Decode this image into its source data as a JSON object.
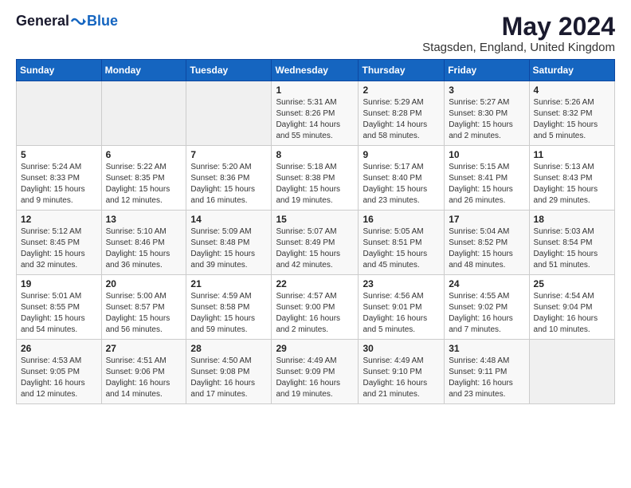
{
  "logo": {
    "general": "General",
    "blue": "Blue"
  },
  "title": "May 2024",
  "subtitle": "Stagsden, England, United Kingdom",
  "headers": [
    "Sunday",
    "Monday",
    "Tuesday",
    "Wednesday",
    "Thursday",
    "Friday",
    "Saturday"
  ],
  "weeks": [
    [
      {
        "day": "",
        "info": ""
      },
      {
        "day": "",
        "info": ""
      },
      {
        "day": "",
        "info": ""
      },
      {
        "day": "1",
        "info": "Sunrise: 5:31 AM\nSunset: 8:26 PM\nDaylight: 14 hours\nand 55 minutes."
      },
      {
        "day": "2",
        "info": "Sunrise: 5:29 AM\nSunset: 8:28 PM\nDaylight: 14 hours\nand 58 minutes."
      },
      {
        "day": "3",
        "info": "Sunrise: 5:27 AM\nSunset: 8:30 PM\nDaylight: 15 hours\nand 2 minutes."
      },
      {
        "day": "4",
        "info": "Sunrise: 5:26 AM\nSunset: 8:32 PM\nDaylight: 15 hours\nand 5 minutes."
      }
    ],
    [
      {
        "day": "5",
        "info": "Sunrise: 5:24 AM\nSunset: 8:33 PM\nDaylight: 15 hours\nand 9 minutes."
      },
      {
        "day": "6",
        "info": "Sunrise: 5:22 AM\nSunset: 8:35 PM\nDaylight: 15 hours\nand 12 minutes."
      },
      {
        "day": "7",
        "info": "Sunrise: 5:20 AM\nSunset: 8:36 PM\nDaylight: 15 hours\nand 16 minutes."
      },
      {
        "day": "8",
        "info": "Sunrise: 5:18 AM\nSunset: 8:38 PM\nDaylight: 15 hours\nand 19 minutes."
      },
      {
        "day": "9",
        "info": "Sunrise: 5:17 AM\nSunset: 8:40 PM\nDaylight: 15 hours\nand 23 minutes."
      },
      {
        "day": "10",
        "info": "Sunrise: 5:15 AM\nSunset: 8:41 PM\nDaylight: 15 hours\nand 26 minutes."
      },
      {
        "day": "11",
        "info": "Sunrise: 5:13 AM\nSunset: 8:43 PM\nDaylight: 15 hours\nand 29 minutes."
      }
    ],
    [
      {
        "day": "12",
        "info": "Sunrise: 5:12 AM\nSunset: 8:45 PM\nDaylight: 15 hours\nand 32 minutes."
      },
      {
        "day": "13",
        "info": "Sunrise: 5:10 AM\nSunset: 8:46 PM\nDaylight: 15 hours\nand 36 minutes."
      },
      {
        "day": "14",
        "info": "Sunrise: 5:09 AM\nSunset: 8:48 PM\nDaylight: 15 hours\nand 39 minutes."
      },
      {
        "day": "15",
        "info": "Sunrise: 5:07 AM\nSunset: 8:49 PM\nDaylight: 15 hours\nand 42 minutes."
      },
      {
        "day": "16",
        "info": "Sunrise: 5:05 AM\nSunset: 8:51 PM\nDaylight: 15 hours\nand 45 minutes."
      },
      {
        "day": "17",
        "info": "Sunrise: 5:04 AM\nSunset: 8:52 PM\nDaylight: 15 hours\nand 48 minutes."
      },
      {
        "day": "18",
        "info": "Sunrise: 5:03 AM\nSunset: 8:54 PM\nDaylight: 15 hours\nand 51 minutes."
      }
    ],
    [
      {
        "day": "19",
        "info": "Sunrise: 5:01 AM\nSunset: 8:55 PM\nDaylight: 15 hours\nand 54 minutes."
      },
      {
        "day": "20",
        "info": "Sunrise: 5:00 AM\nSunset: 8:57 PM\nDaylight: 15 hours\nand 56 minutes."
      },
      {
        "day": "21",
        "info": "Sunrise: 4:59 AM\nSunset: 8:58 PM\nDaylight: 15 hours\nand 59 minutes."
      },
      {
        "day": "22",
        "info": "Sunrise: 4:57 AM\nSunset: 9:00 PM\nDaylight: 16 hours\nand 2 minutes."
      },
      {
        "day": "23",
        "info": "Sunrise: 4:56 AM\nSunset: 9:01 PM\nDaylight: 16 hours\nand 5 minutes."
      },
      {
        "day": "24",
        "info": "Sunrise: 4:55 AM\nSunset: 9:02 PM\nDaylight: 16 hours\nand 7 minutes."
      },
      {
        "day": "25",
        "info": "Sunrise: 4:54 AM\nSunset: 9:04 PM\nDaylight: 16 hours\nand 10 minutes."
      }
    ],
    [
      {
        "day": "26",
        "info": "Sunrise: 4:53 AM\nSunset: 9:05 PM\nDaylight: 16 hours\nand 12 minutes."
      },
      {
        "day": "27",
        "info": "Sunrise: 4:51 AM\nSunset: 9:06 PM\nDaylight: 16 hours\nand 14 minutes."
      },
      {
        "day": "28",
        "info": "Sunrise: 4:50 AM\nSunset: 9:08 PM\nDaylight: 16 hours\nand 17 minutes."
      },
      {
        "day": "29",
        "info": "Sunrise: 4:49 AM\nSunset: 9:09 PM\nDaylight: 16 hours\nand 19 minutes."
      },
      {
        "day": "30",
        "info": "Sunrise: 4:49 AM\nSunset: 9:10 PM\nDaylight: 16 hours\nand 21 minutes."
      },
      {
        "day": "31",
        "info": "Sunrise: 4:48 AM\nSunset: 9:11 PM\nDaylight: 16 hours\nand 23 minutes."
      },
      {
        "day": "",
        "info": ""
      }
    ]
  ]
}
